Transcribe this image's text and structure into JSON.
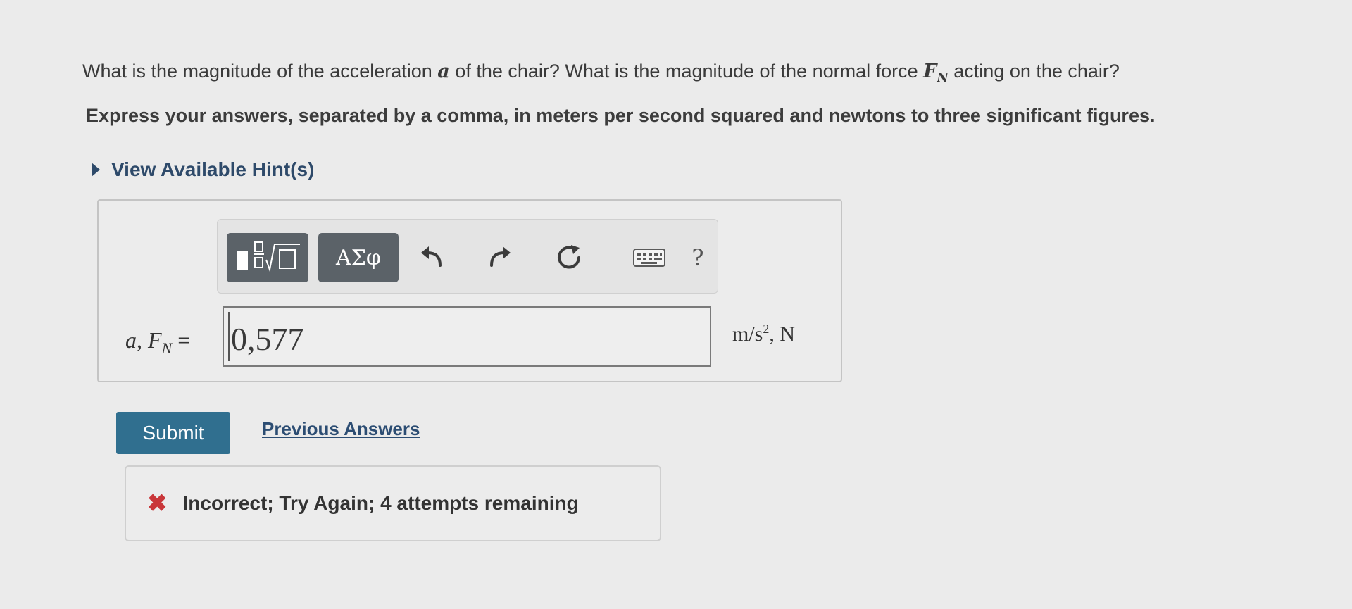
{
  "question": {
    "part1": "What is the magnitude of the acceleration ",
    "var_a": "a",
    "part2": " of the chair? What is the magnitude of the normal force ",
    "var_F": "F",
    "var_F_sub": "N",
    "part3": " acting on the chair?"
  },
  "instructions": "Express your answers, separated by a comma, in meters per second squared and newtons to three significant figures.",
  "hint": {
    "label": "View Available Hint(s)"
  },
  "toolbar": {
    "greek_label": "ΑΣφ",
    "help_label": "?",
    "icons": [
      "template-icon",
      "undo-icon",
      "redo-icon",
      "reset-icon",
      "keyboard-icon",
      "help-icon"
    ]
  },
  "answer": {
    "label_a": "a",
    "label_sep": ", ",
    "label_F": "F",
    "label_F_sub": "N",
    "label_eq": " =",
    "value": "0,577",
    "units_base": "m/s",
    "units_exp": "2",
    "units_rest": ", N"
  },
  "actions": {
    "submit_label": "Submit",
    "previous_label": "Previous Answers"
  },
  "feedback": {
    "message": "Incorrect; Try Again; 4 attempts remaining",
    "status_color": "#c9373a"
  },
  "colors": {
    "submit_bg": "#306f8f",
    "link": "#2c4d73",
    "toolbar_btn": "#5b6268"
  }
}
